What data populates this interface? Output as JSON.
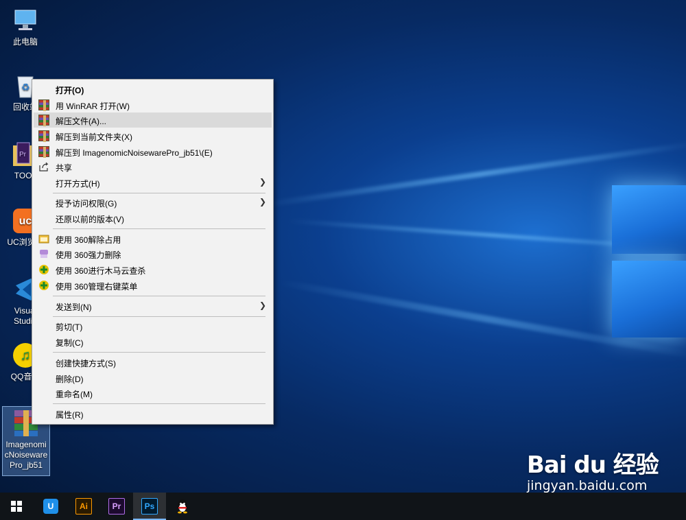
{
  "desktop": {
    "icons": [
      {
        "label": "此电脑"
      },
      {
        "label": "回收站"
      },
      {
        "label": "TOOL"
      },
      {
        "label": "UC浏览器"
      },
      {
        "label": "Visual Studio"
      },
      {
        "label": "QQ音乐"
      },
      {
        "label_lines": [
          "Imagenomi",
          "cNoiseware",
          "Pro_jb51"
        ]
      }
    ]
  },
  "context_menu": {
    "items": [
      {
        "label": "打开(O)"
      },
      {
        "label": "用 WinRAR 打开(W)"
      },
      {
        "label": "解压文件(A)..."
      },
      {
        "label": "解压到当前文件夹(X)"
      },
      {
        "label": "解压到 ImagenomicNoisewarePro_jb51\\(E)"
      },
      {
        "label": "共享"
      },
      {
        "label": "打开方式(H)"
      },
      {
        "label": "授予访问权限(G)"
      },
      {
        "label": "还原以前的版本(V)"
      },
      {
        "label": "使用 360解除占用"
      },
      {
        "label": "使用 360强力删除"
      },
      {
        "label": "使用 360进行木马云查杀"
      },
      {
        "label": "使用 360管理右键菜单"
      },
      {
        "label": "发送到(N)"
      },
      {
        "label": "剪切(T)"
      },
      {
        "label": "复制(C)"
      },
      {
        "label": "创建快捷方式(S)"
      },
      {
        "label": "删除(D)"
      },
      {
        "label": "重命名(M)"
      },
      {
        "label": "属性(R)"
      }
    ],
    "highlighted_item": "解压文件(A)...",
    "submenu_arrow": "❯"
  },
  "taskbar": {
    "items": [
      {
        "icon": "start-icon"
      },
      {
        "icon": "360-browser-icon",
        "text": "U"
      },
      {
        "icon": "illustrator-icon",
        "text": "Ai"
      },
      {
        "icon": "premiere-icon",
        "text": "Pr"
      },
      {
        "icon": "photoshop-icon",
        "text": "Ps"
      },
      {
        "icon": "qq-icon"
      }
    ]
  },
  "watermark": {
    "logo": "Bai du 经验",
    "url": "jingyan.baidu.com"
  }
}
